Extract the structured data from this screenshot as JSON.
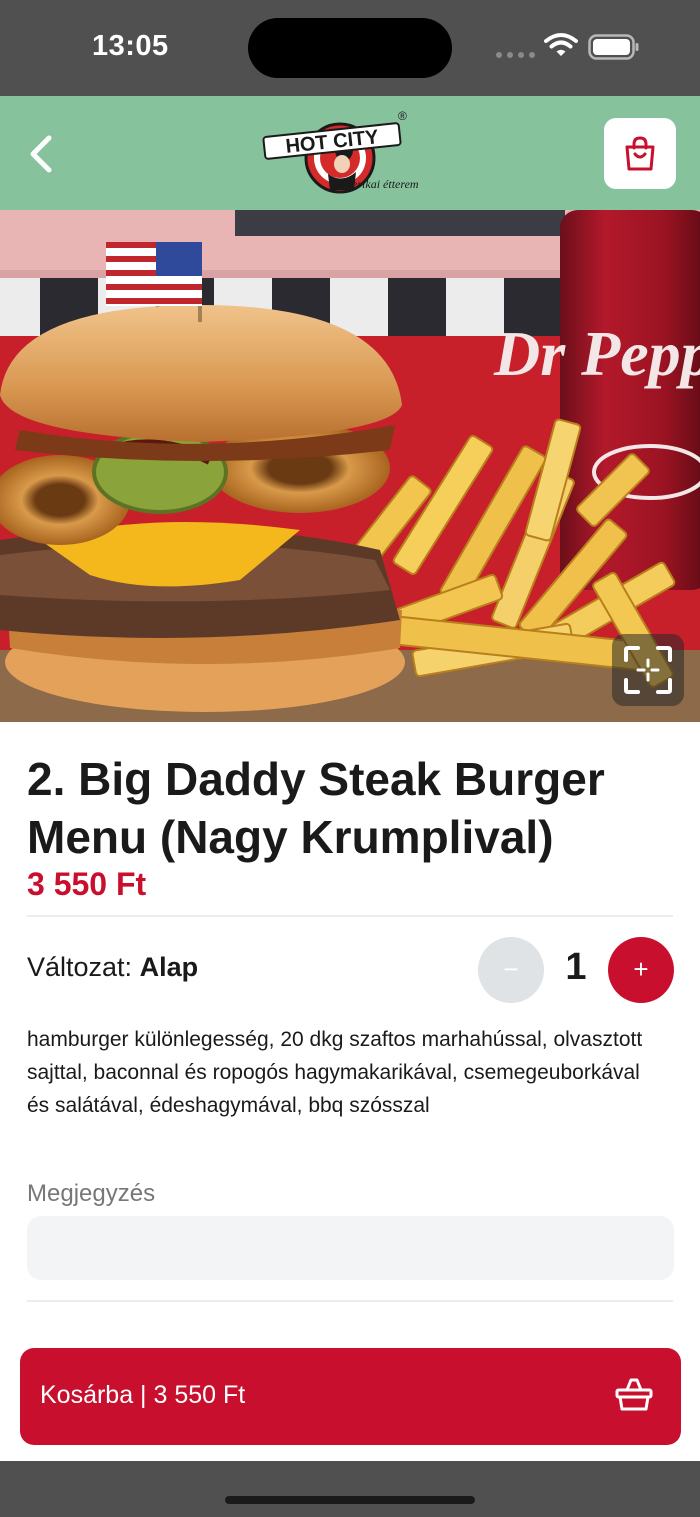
{
  "status_bar": {
    "time": "13:05"
  },
  "header": {
    "logo": {
      "brand": "HOT CITY",
      "tagline": "amerikai étterem",
      "mark": "®"
    },
    "back_icon": "chevron-left-icon",
    "cart_icon": "shopping-bag-icon"
  },
  "product": {
    "title": "2. Big Daddy Steak Burger Menu (Nagy Krumplival)",
    "price": "3 550 Ft",
    "variant_label": "Változat:",
    "variant_value": "Alap",
    "quantity": "1",
    "minus_label": "−",
    "plus_label": "+",
    "description": "hamburger különlegesség, 20 dkg szaftos marhahússal, olvasztott sajttal, baconnal és ropogós hagymakarikával, csemegeuborkával és salátával, édeshagymával, bbq szósszal",
    "note_label": "Megjegyzés",
    "note_value": "",
    "image_can_text": "Dr Pepper"
  },
  "footer": {
    "add_to_cart_label": "Kosárba | 3 550 Ft",
    "basket_icon": "basket-icon"
  },
  "colors": {
    "brand_red": "#c8102e",
    "header_green": "#86c29c",
    "status_gray": "#505050",
    "note_bg": "#f2f4f5",
    "minus_bg": "#dfe3e6"
  }
}
